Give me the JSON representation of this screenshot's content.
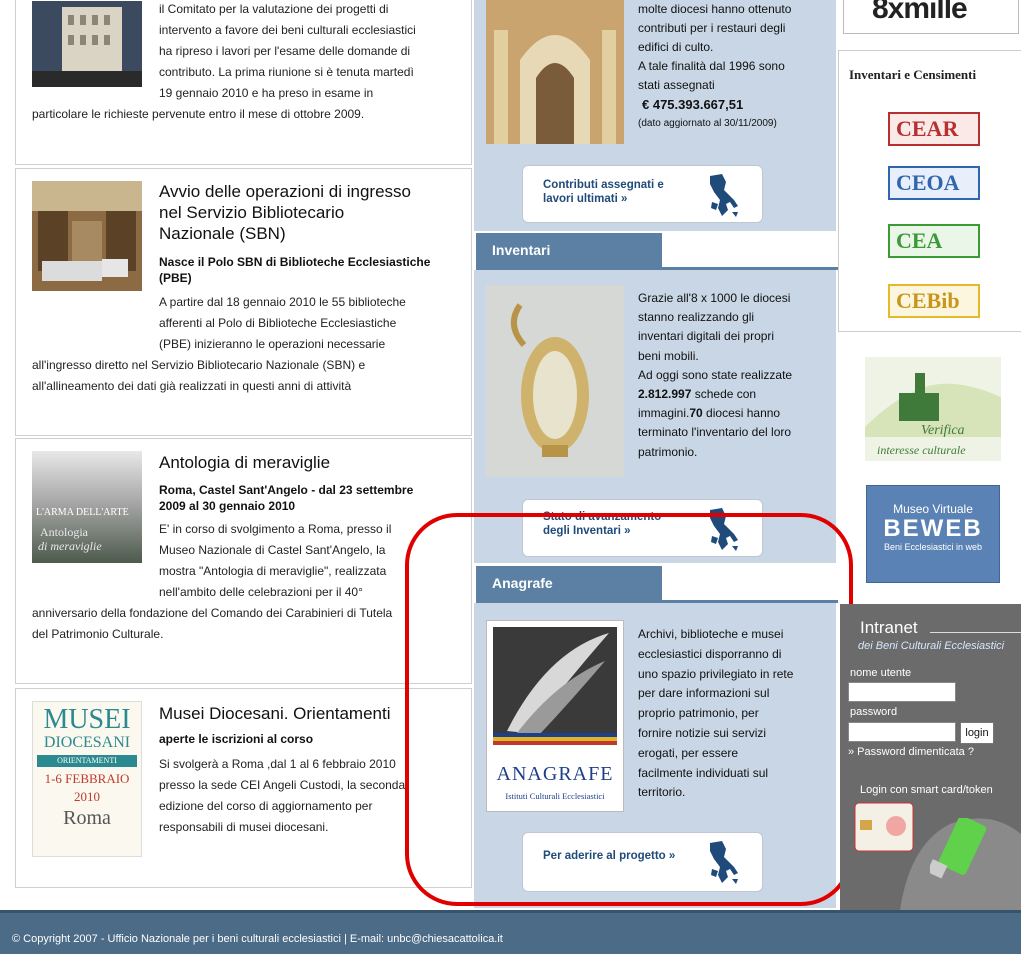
{
  "news": [
    {
      "body_lines": [
        "il Comitato per la valutazione dei progetti di",
        "intervento a favore dei beni culturali ecclesiastici",
        "ha ripreso i lavori per l'esame delle domande di",
        "contributo. La prima riunione si è tenuta martedì",
        "19 gennaio 2010 e ha preso in esame in",
        "particolare le richieste pervenute entro il mese di ottobre 2009."
      ]
    },
    {
      "title_lines": [
        "Avvio delle operazioni di ingresso",
        "nel Servizio Bibliotecario",
        "Nazionale (SBN)"
      ],
      "sub_lines": [
        "Nasce il Polo SBN di Biblioteche Ecclesiastiche",
        "(PBE)"
      ],
      "body_lines": [
        "A partire dal 18 gennaio 2010 le 55 biblioteche",
        "afferenti al Polo di Biblioteche Ecclesiastiche",
        "(PBE) inizieranno le operazioni necessarie",
        "all'ingresso diretto nel Servizio Bibliotecario Nazionale (SBN) e",
        "all'allineamento dei dati già realizzati in questi anni di attività"
      ]
    },
    {
      "title_lines": [
        "Antologia di meraviglie"
      ],
      "sub_lines": [
        "Roma, Castel Sant'Angelo - dal 23 settembre",
        "2009 al 30 gennaio 2010"
      ],
      "thumb_text": [
        "L'ARMA DELL'ARTE",
        "Antologia",
        "di meraviglie"
      ],
      "body_lines": [
        "E' in corso di svolgimento a Roma, presso il",
        "Museo Nazionale di Castel Sant'Angelo, la",
        "mostra \"Antologia di meraviglie\", realizzata",
        "nell'ambito delle celebrazioni per il 40°",
        "anniversario della fondazione del Comando dei Carabinieri di Tutela",
        "del Patrimonio Culturale."
      ]
    },
    {
      "title_lines": [
        "Musei Diocesani. Orientamenti"
      ],
      "sub_lines": [
        "aperte le iscrizioni al corso"
      ],
      "thumb_text": [
        "MUSEI",
        "DIOCESANI",
        "ORIENTAMENTI",
        "1-6 FEBBRAIO",
        "2010",
        "Roma"
      ],
      "body_lines": [
        "Si svolgerà a Roma ,dal 1 al 6 febbraio 2010",
        "presso la sede CEI Angeli Custodi, la seconda",
        "edizione del corso di aggiornamento per",
        "responsabili di musei diocesani."
      ]
    }
  ],
  "contributi": {
    "lines": [
      "molte diocesi hanno ottenuto",
      "contributi per i restauri degli",
      "edifici di culto.",
      "A tale finalità dal 1996 sono",
      "stati assegnati"
    ],
    "amount": "€ 475.393.667,51",
    "note": "(dato aggiornato al 30/11/2009)",
    "button": [
      "Contributi assegnati e",
      "lavori ultimati »"
    ]
  },
  "inventari": {
    "tab": "Inventari",
    "lines_a": [
      "Grazie all'8 x 1000 le diocesi",
      "stanno realizzando gli",
      "inventari digitali dei propri",
      "beni mobili.",
      "Ad oggi sono state realizzate"
    ],
    "count_schede": "2.812.997",
    "schede_text": " schede con",
    "immagini_text": "immagini.",
    "count_diocesi": "70",
    "diocesi_text": " diocesi hanno",
    "lines_b": [
      "terminato l'inventario del loro",
      "patrimonio."
    ],
    "button": [
      "Stato di avanzamento",
      "degli Inventari »"
    ]
  },
  "anagrafe": {
    "tab": "Anagrafe",
    "lines": [
      "Archivi, biblioteche e musei",
      "ecclesiastici disporranno di",
      "uno spazio privilegiato in rete",
      "per dare informazioni sul",
      "proprio patrimonio, per",
      "fornire notizie sui servizi",
      "erogati, per essere",
      "facilmente individuati sul",
      "territorio."
    ],
    "logo_title": "ANAGRAFE",
    "logo_sub": "Istituti Culturali Ecclesiastici",
    "button": [
      "Per aderire al progetto »"
    ]
  },
  "sidebar": {
    "banner_8x": "8xmille",
    "inv_title": "Inventari e Censimenti",
    "ce_badges": [
      {
        "label": "CEAR",
        "color": "#b5302e"
      },
      {
        "label": "CEOA",
        "color": "#2f66b0"
      },
      {
        "label": "CEA",
        "color": "#3b9a34"
      },
      {
        "label": "CEBib",
        "color": "#e5b92a"
      }
    ],
    "verifica_lines": [
      "Verifica",
      "interesse culturale"
    ],
    "bewb_title": "Museo Virtuale",
    "bewb_logo": "BEWEB",
    "bewb_sub": "Beni Ecclesiastici in web"
  },
  "intranet": {
    "title": "Intranet",
    "subtitle": "dei Beni Culturali Ecclesiastici",
    "username_label": "nome utente",
    "password_label": "password",
    "login_button": "login",
    "forgot": "» Password dimenticata ?",
    "smart": "Login con smart card/token"
  },
  "footer": {
    "text": "© Copyright 2007 - Ufficio Nazionale per i beni culturali ecclesiastici  | E-mail: unbc@chiesacattolica.it"
  },
  "colors": {
    "accent_tab": "#5b80a4",
    "highlight": "#e00000"
  }
}
